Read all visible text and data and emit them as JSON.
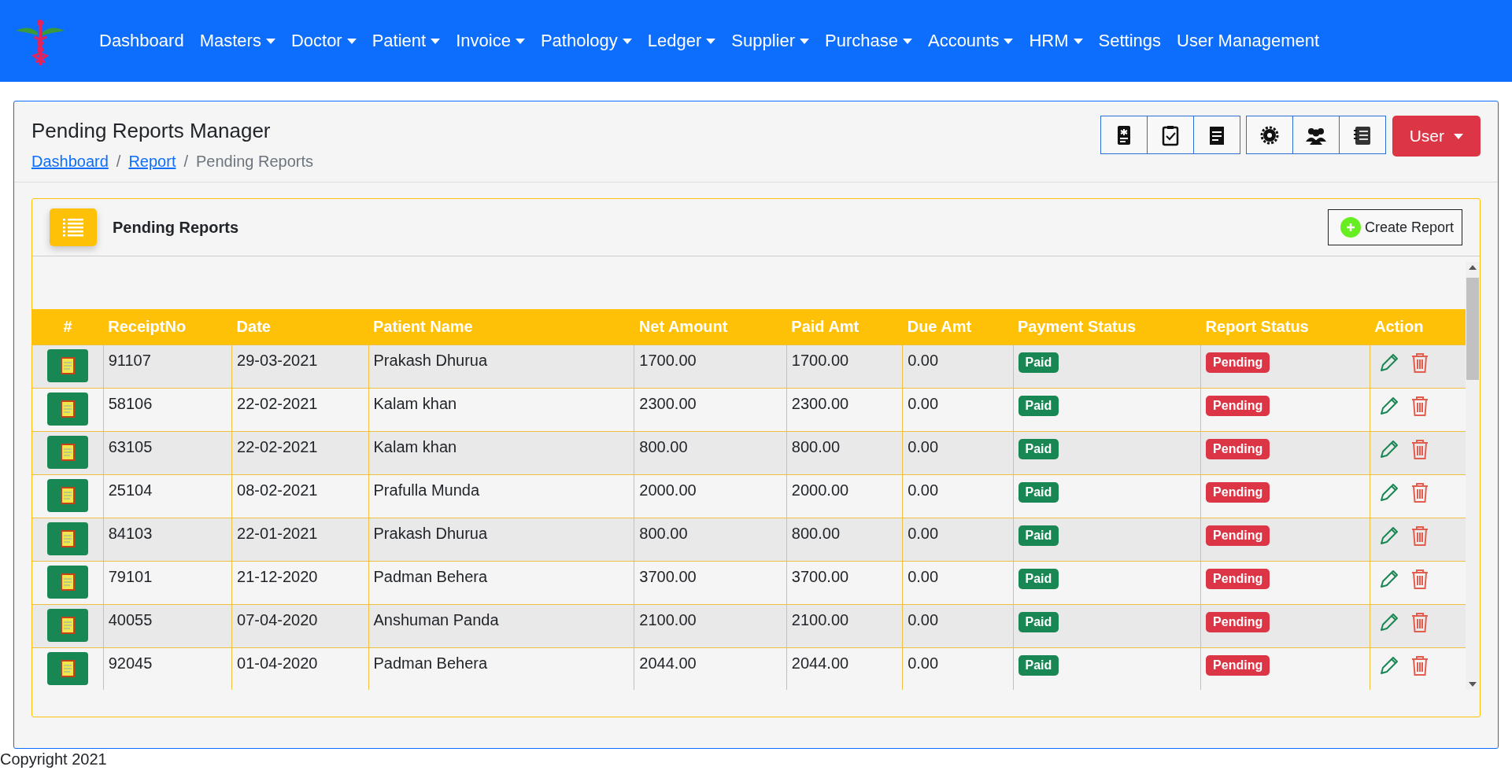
{
  "navbar": {
    "items": [
      {
        "label": "Dashboard",
        "dropdown": false
      },
      {
        "label": "Masters",
        "dropdown": true
      },
      {
        "label": "Doctor",
        "dropdown": true
      },
      {
        "label": "Patient",
        "dropdown": true
      },
      {
        "label": "Invoice",
        "dropdown": true
      },
      {
        "label": "Pathology",
        "dropdown": true
      },
      {
        "label": "Ledger",
        "dropdown": true
      },
      {
        "label": "Supplier",
        "dropdown": true
      },
      {
        "label": "Purchase",
        "dropdown": true
      },
      {
        "label": "Accounts",
        "dropdown": true
      },
      {
        "label": "HRM",
        "dropdown": true
      },
      {
        "label": "Settings",
        "dropdown": false
      },
      {
        "label": "User Management",
        "dropdown": false
      }
    ]
  },
  "page": {
    "title": "Pending Reports Manager",
    "breadcrumb": [
      {
        "label": "Dashboard",
        "link": true
      },
      {
        "label": "Report",
        "link": true
      },
      {
        "label": "Pending Reports",
        "link": false
      }
    ],
    "breadcrumb_separator": "/",
    "user_button": "User"
  },
  "panel": {
    "title": "Pending Reports",
    "create_button": "Create Report"
  },
  "table": {
    "columns": [
      "#",
      "ReceiptNo",
      "Date",
      "Patient Name",
      "Net Amount",
      "Paid Amt",
      "Due Amt",
      "Payment Status",
      "Report Status",
      "Action"
    ],
    "rows": [
      {
        "receipt_no": "91107",
        "date": "29-03-2021",
        "patient_name": "Prakash Dhurua",
        "net_amount": "1700.00",
        "paid_amt": "1700.00",
        "due_amt": "0.00",
        "payment_status": "Paid",
        "report_status": "Pending"
      },
      {
        "receipt_no": "58106",
        "date": "22-02-2021",
        "patient_name": "Kalam khan",
        "net_amount": "2300.00",
        "paid_amt": "2300.00",
        "due_amt": "0.00",
        "payment_status": "Paid",
        "report_status": "Pending"
      },
      {
        "receipt_no": "63105",
        "date": "22-02-2021",
        "patient_name": "Kalam khan",
        "net_amount": "800.00",
        "paid_amt": "800.00",
        "due_amt": "0.00",
        "payment_status": "Paid",
        "report_status": "Pending"
      },
      {
        "receipt_no": "25104",
        "date": "08-02-2021",
        "patient_name": "Prafulla Munda",
        "net_amount": "2000.00",
        "paid_amt": "2000.00",
        "due_amt": "0.00",
        "payment_status": "Paid",
        "report_status": "Pending"
      },
      {
        "receipt_no": "84103",
        "date": "22-01-2021",
        "patient_name": "Prakash Dhurua",
        "net_amount": "800.00",
        "paid_amt": "800.00",
        "due_amt": "0.00",
        "payment_status": "Paid",
        "report_status": "Pending"
      },
      {
        "receipt_no": "79101",
        "date": "21-12-2020",
        "patient_name": "Padman Behera",
        "net_amount": "3700.00",
        "paid_amt": "3700.00",
        "due_amt": "0.00",
        "payment_status": "Paid",
        "report_status": "Pending"
      },
      {
        "receipt_no": "40055",
        "date": "07-04-2020",
        "patient_name": "Anshuman Panda",
        "net_amount": "2100.00",
        "paid_amt": "2100.00",
        "due_amt": "0.00",
        "payment_status": "Paid",
        "report_status": "Pending"
      },
      {
        "receipt_no": "92045",
        "date": "01-04-2020",
        "patient_name": "Padman Behera",
        "net_amount": "2044.00",
        "paid_amt": "2044.00",
        "due_amt": "0.00",
        "payment_status": "Paid",
        "report_status": "Pending"
      }
    ]
  },
  "footer": {
    "copyright": "Copyright 2021"
  }
}
